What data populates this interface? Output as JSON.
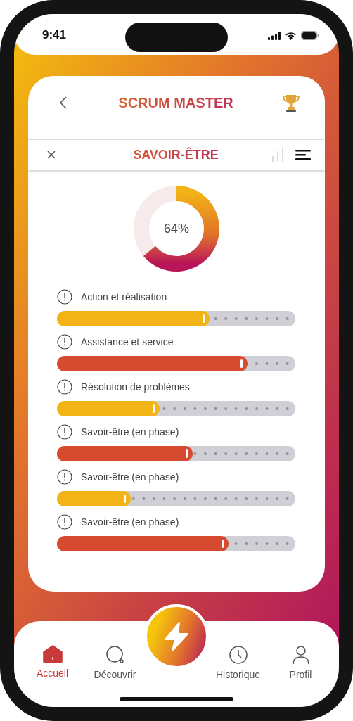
{
  "status_bar": {
    "time": "9:41"
  },
  "header": {
    "title": "SCRUM MASTER"
  },
  "subheader": {
    "title": "SAVOIR-ÊTRE"
  },
  "donut": {
    "label": "64%"
  },
  "skills": [
    {
      "label": "Action et réalisation",
      "level": 0.64,
      "color": "#f2b316"
    },
    {
      "label": "Assistance et service",
      "level": 0.8,
      "color": "#d64b30"
    },
    {
      "label": "Résolution de problèmes",
      "level": 0.43,
      "color": "#f2b316"
    },
    {
      "label": "Savoir-être (en phase)",
      "level": 0.57,
      "color": "#d64b30"
    },
    {
      "label": "Savoir-être (en phase)",
      "level": 0.31,
      "color": "#f2b316"
    },
    {
      "label": "Savoir-être (en phase)",
      "level": 0.72,
      "color": "#d64b30"
    }
  ],
  "tab_bar": [
    {
      "label": "Accueil",
      "kind": "home",
      "selected": true
    },
    {
      "label": "Découvrir",
      "kind": "discover",
      "selected": false
    },
    {
      "label": "Historique",
      "kind": "history",
      "selected": false
    },
    {
      "label": "Profil",
      "kind": "profile",
      "selected": false
    }
  ]
}
